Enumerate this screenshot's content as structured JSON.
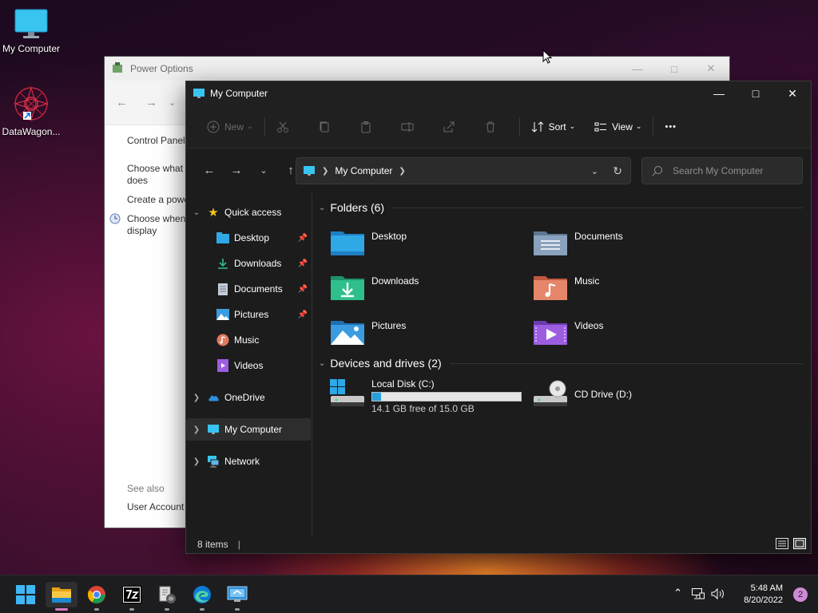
{
  "desktop": {
    "icons": [
      {
        "label": "My Computer"
      },
      {
        "label": "DataWagon..."
      }
    ]
  },
  "power_options": {
    "title": "Power Options",
    "side_links": [
      "Control Panel",
      "Choose what",
      "does",
      "Create a powe",
      "Choose when",
      "display"
    ],
    "see_also_label": "See also",
    "user_accounts": "User Account"
  },
  "explorer": {
    "title": "My Computer",
    "toolbar": {
      "new_label": "New",
      "sort_label": "Sort",
      "view_label": "View",
      "more_label": "•••"
    },
    "address": {
      "path": "My Computer"
    },
    "search": {
      "placeholder": "Search My Computer"
    },
    "nav": {
      "quick_access": "Quick access",
      "items": [
        {
          "label": "Desktop",
          "icon": "desktop-folder-icon",
          "pinned": true
        },
        {
          "label": "Downloads",
          "icon": "download-icon",
          "pinned": true
        },
        {
          "label": "Documents",
          "icon": "document-icon",
          "pinned": true
        },
        {
          "label": "Pictures",
          "icon": "picture-icon",
          "pinned": true
        },
        {
          "label": "Music",
          "icon": "music-icon",
          "pinned": false
        },
        {
          "label": "Videos",
          "icon": "video-icon",
          "pinned": false
        }
      ],
      "onedrive": "OneDrive",
      "my_computer": "My Computer",
      "network": "Network"
    },
    "folders_header": "Folders (6)",
    "folders": [
      {
        "name": "Desktop",
        "color": "#2fa8e6"
      },
      {
        "name": "Documents",
        "color": "#8aa2bd"
      },
      {
        "name": "Downloads",
        "color": "#2fbf8a"
      },
      {
        "name": "Music",
        "color": "#e08060"
      },
      {
        "name": "Pictures",
        "color": "#3a9be0"
      },
      {
        "name": "Videos",
        "color": "#9b5ee0"
      }
    ],
    "drives_header": "Devices and drives (2)",
    "drives": [
      {
        "name": "Local Disk (C:)",
        "free_text": "14.1 GB free of 15.0 GB",
        "used_fraction": 0.06
      },
      {
        "name": "CD Drive (D:)"
      }
    ],
    "status": {
      "items": "8 items"
    }
  },
  "taskbar": {
    "apps": [
      "start",
      "file-explorer",
      "chrome",
      "7zip",
      "archive-tool",
      "edge",
      "remote-desktop"
    ],
    "time": "5:48 AM",
    "date": "8/20/2022",
    "notification_count": "2"
  },
  "colors": {
    "accent": "#2fa8e6",
    "taskbar_active": "#d67ec0",
    "explorer_bg": "#1c1c1c"
  }
}
